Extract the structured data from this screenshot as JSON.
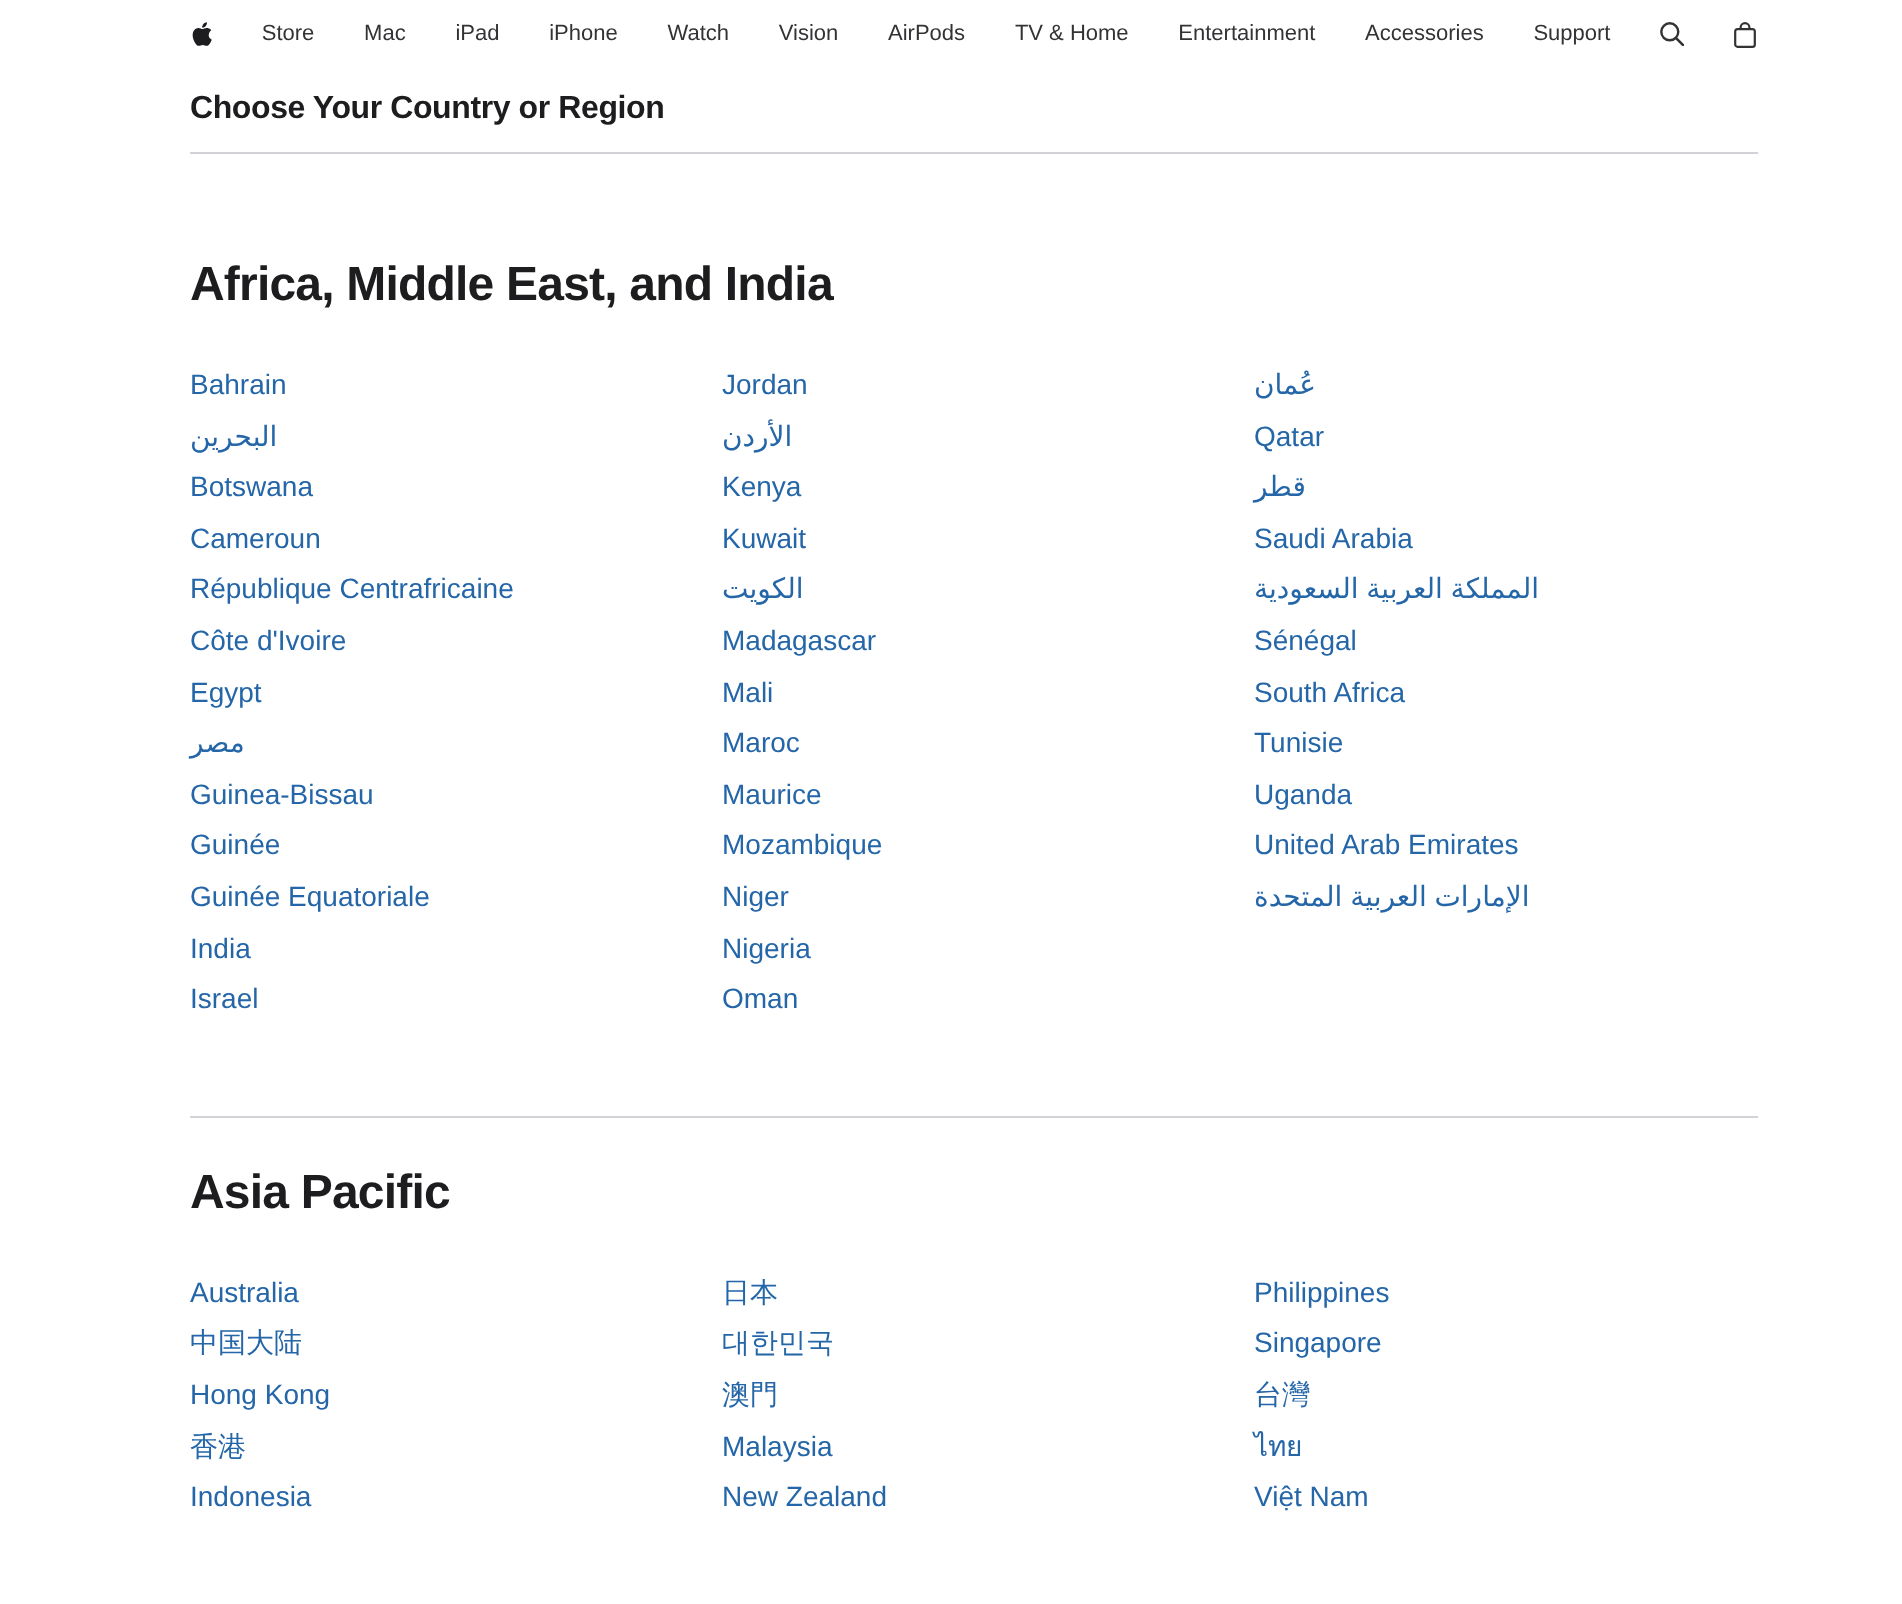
{
  "nav": {
    "items": [
      "Store",
      "Mac",
      "iPad",
      "iPhone",
      "Watch",
      "Vision",
      "AirPods",
      "TV & Home",
      "Entertainment",
      "Accessories",
      "Support"
    ]
  },
  "title": "Choose Your Country or Region",
  "regions": [
    {
      "heading": "Africa, Middle East, and India",
      "countries": [
        "Bahrain",
        "البحرين",
        "Botswana",
        "Cameroun",
        "République Centrafricaine",
        "Côte d'Ivoire",
        "Egypt",
        "مصر",
        "Guinea-Bissau",
        "Guinée",
        "Guinée Equatoriale",
        "India",
        "Israel",
        "Jordan",
        "الأردن",
        "Kenya",
        "Kuwait",
        "الكويت",
        "Madagascar",
        "Mali",
        "Maroc",
        "Maurice",
        "Mozambique",
        "Niger",
        "Nigeria",
        "Oman",
        "عُمان",
        "Qatar",
        "قطر",
        "Saudi Arabia",
        "المملكة العربية السعودية",
        "Sénégal",
        "South Africa",
        "Tunisie",
        "Uganda",
        "United Arab Emirates",
        "الإمارات العربية المتحدة"
      ]
    },
    {
      "heading": "Asia Pacific",
      "countries": [
        "Australia",
        "中国大陆",
        "Hong Kong",
        "香港",
        "Indonesia",
        "日本",
        "대한민국",
        "澳門",
        "Malaysia",
        "New Zealand",
        "Philippines",
        "Singapore",
        "台灣",
        "ไทย",
        "Việt Nam"
      ]
    }
  ]
}
